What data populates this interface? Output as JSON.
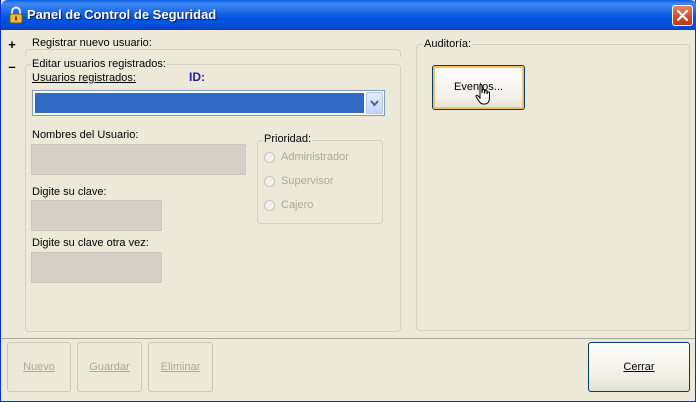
{
  "window": {
    "title": "Panel de Control de Seguridad"
  },
  "register_section": {
    "expander": "+",
    "label": "Registrar nuevo usuario:"
  },
  "edit_section": {
    "expander": "–",
    "label": "Editar usuarios registrados:",
    "users_label": "Usuarios registrados:",
    "id_label": "ID:",
    "user_names_label": "Nombres del Usuario:",
    "password_label": "Digite su clave:",
    "password_confirm_label": "Digite su clave otra vez:",
    "priority": {
      "label": "Prioridad:",
      "options": [
        "Administrador",
        "Supervisor",
        "Cajero"
      ]
    }
  },
  "audit_section": {
    "label": "Auditoría:",
    "events_button": "Eventos..."
  },
  "bottom_buttons": {
    "nuevo": "Nuevo",
    "guardar": "Guardar",
    "eliminar": "Eliminar",
    "cerrar": "Cerrar"
  },
  "colors": {
    "selection": "#316ac5",
    "titlebar": "#0054e3"
  }
}
